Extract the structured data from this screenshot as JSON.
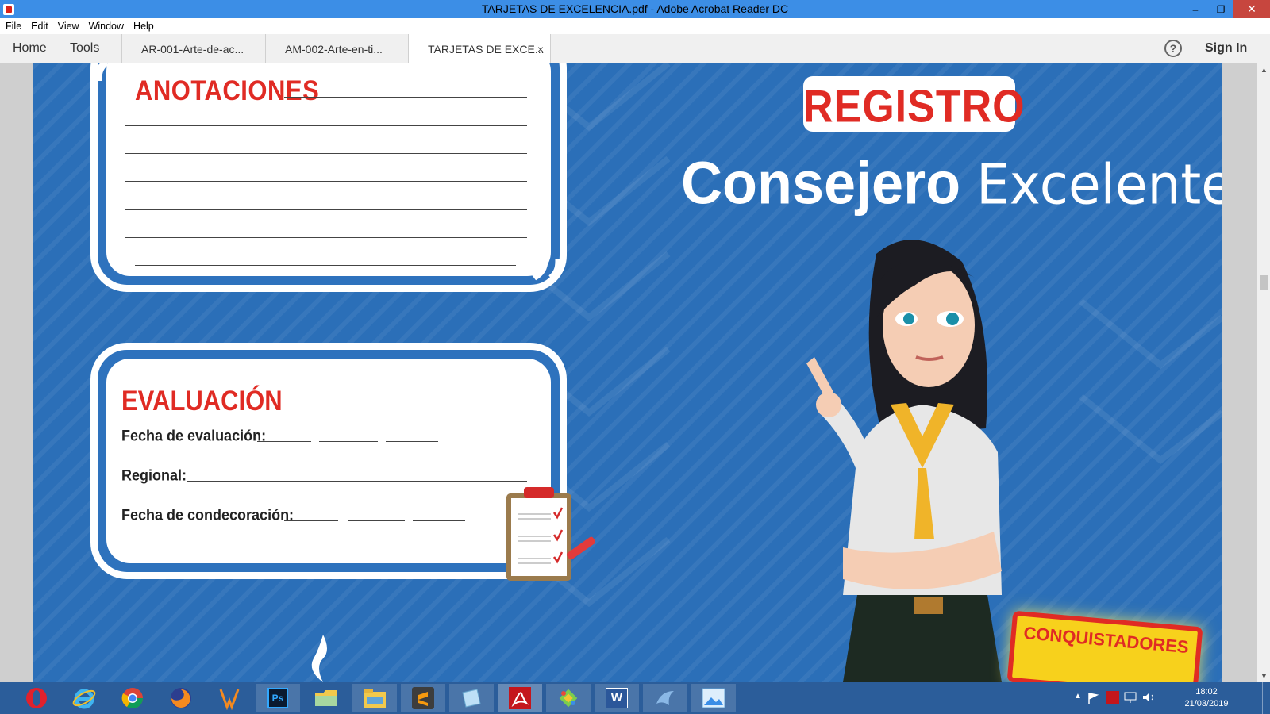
{
  "window": {
    "title": "TARJETAS DE EXCELENCIA.pdf - Adobe Acrobat Reader DC",
    "controls": {
      "minimize": "–",
      "restore": "❐",
      "close": "✕"
    }
  },
  "menu": {
    "items": [
      "File",
      "Edit",
      "View",
      "Window",
      "Help"
    ]
  },
  "toolbar": {
    "home": "Home",
    "tools": "Tools",
    "tabs": [
      {
        "label": "AR-001-Arte-de-ac..."
      },
      {
        "label": "AM-002-Arte-en-ti..."
      },
      {
        "label": "TARJETAS DE EXCE...",
        "close": "×"
      }
    ],
    "help": "?",
    "sign_in": "Sign In"
  },
  "document": {
    "anotaciones_title": "ANOTACIONES",
    "quote_open": "“",
    "quote_close": "”",
    "evaluacion_title": "EVALUACIÓN",
    "fecha_evaluacion": "Fecha de evaluación:",
    "regional": "Regional:",
    "fecha_condecoracion": "Fecha de condecoración:",
    "registro": "REGISTRO",
    "consejero_bold": "Consejero",
    "consejero_light": "Excelente",
    "badge": "CONQUISTADORES"
  },
  "taskbar": {
    "apps": [
      "opera-icon",
      "internet-explorer-icon",
      "chrome-icon",
      "firefox-icon",
      "winamp-icon",
      "photoshop-icon",
      "folder-icon",
      "file-explorer-icon",
      "sublime-icon",
      "notepad-icon",
      "acrobat-icon",
      "paint-icon",
      "word-icon",
      "dolphin-icon",
      "photos-icon"
    ],
    "ps_label": "Ps",
    "word_label": "W",
    "time": "18:02",
    "date": "21/03/2019"
  },
  "colors": {
    "accent_blue": "#2b6fb8",
    "title_red": "#e02b24",
    "titlebar": "#3c8ee6",
    "taskbar": "#2b5d9a"
  }
}
